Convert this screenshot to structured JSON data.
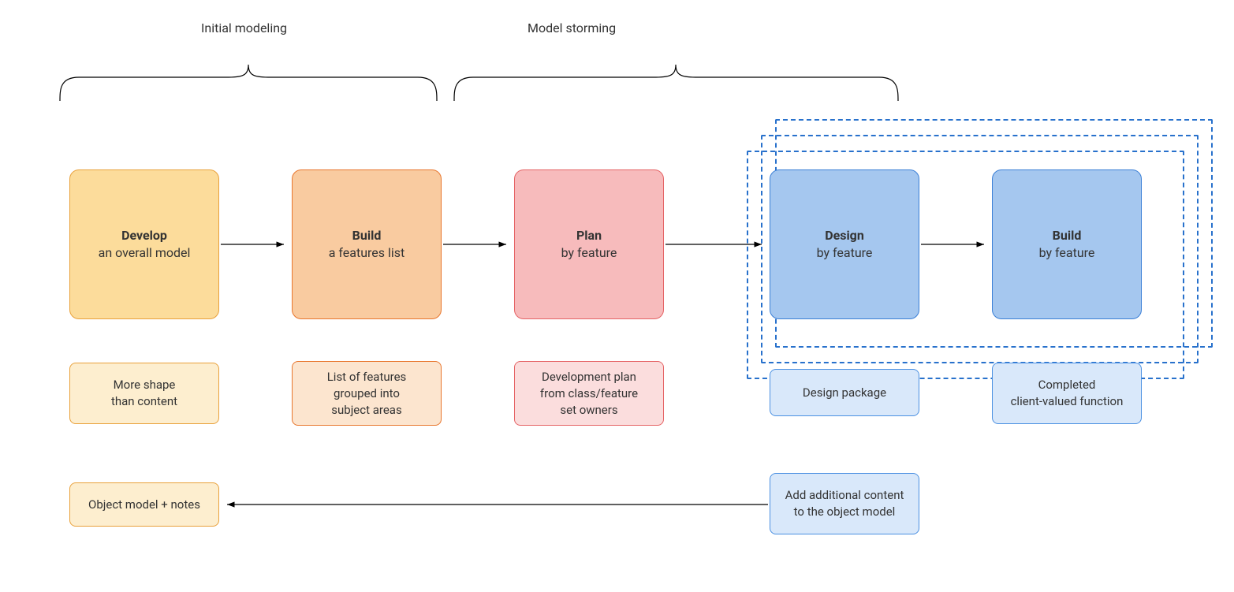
{
  "phases": {
    "initial": "Initial modeling",
    "storming": "Model storming"
  },
  "boxes": {
    "develop": {
      "title": "Develop",
      "sub": "an overall model"
    },
    "build1": {
      "title": "Build",
      "sub": "a features list"
    },
    "plan": {
      "title": "Plan",
      "sub": "by feature"
    },
    "design": {
      "title": "Design",
      "sub": "by feature"
    },
    "build2": {
      "title": "Build",
      "sub": "by feature"
    }
  },
  "notes": {
    "develop": "More shape\nthan content",
    "build1": "List of features\ngrouped into\nsubject areas",
    "plan": "Development plan\nfrom class/feature\nset owners",
    "design": "Design package",
    "build2": "Completed\nclient-valued function",
    "addcontent": "Add additional content\nto the object model",
    "objectmodel": "Object model + notes"
  },
  "colors": {
    "yellow_fill": "#fcdc9b",
    "yellow_border": "#e9a13b",
    "yellow_light": "#fdeecf",
    "orange_fill": "#f9cba0",
    "orange_border": "#e8762d",
    "orange_light": "#fce5cf",
    "red_fill": "#f7bbbc",
    "red_border": "#e56365",
    "red_light": "#fbdddd",
    "blue_fill": "#b5d1f2",
    "blue_border": "#4b90e2",
    "blue_light": "#d9e8fa",
    "blue2_fill": "#a5c7ef",
    "blue2_border": "#3a7fd6"
  }
}
